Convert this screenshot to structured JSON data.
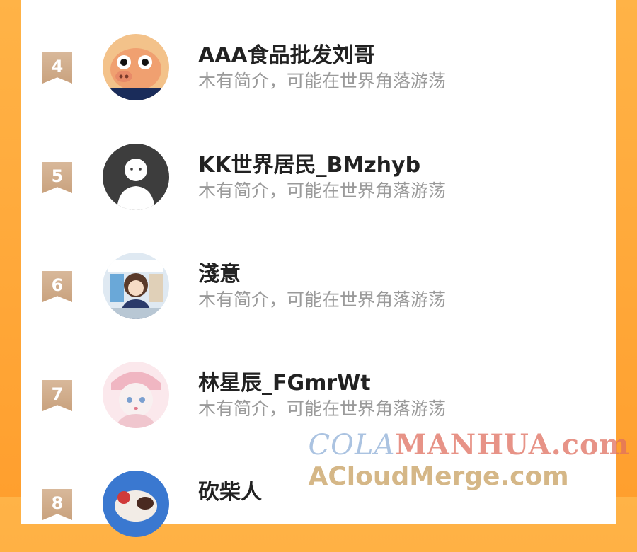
{
  "list": [
    {
      "rank": "4",
      "name": "AAA食品批发刘哥",
      "intro": "木有简介，可能在世界角落游荡"
    },
    {
      "rank": "5",
      "name": "KK世界居民_BMzhyb",
      "intro": "木有简介，可能在世界角落游荡"
    },
    {
      "rank": "6",
      "name": "淺意",
      "intro": "木有简介，可能在世界角落游荡"
    },
    {
      "rank": "7",
      "name": "林星辰_FGmrWt",
      "intro": "木有简介，可能在世界角落游荡"
    },
    {
      "rank": "8",
      "name": "砍柴人",
      "intro": ""
    }
  ],
  "watermark": {
    "line1_part1": "COLA",
    "line1_part2": "MANHUA.com",
    "line2": "ACloudMerge.com"
  }
}
